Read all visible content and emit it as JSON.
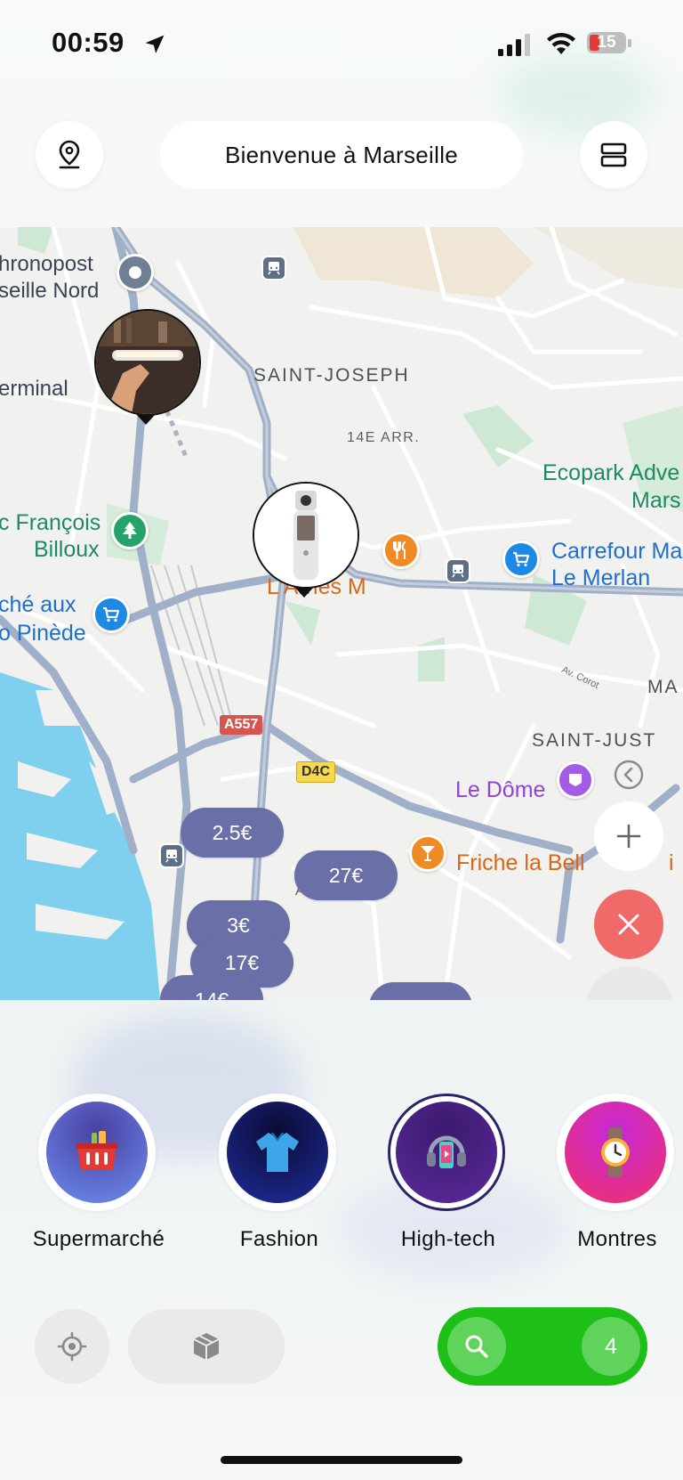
{
  "status_bar": {
    "time": "00:59",
    "battery": "15"
  },
  "header": {
    "title": "Bienvenue à Marseille"
  },
  "map": {
    "labels": {
      "chronopost_1": "hronopost",
      "chronopost_2": "seille Nord",
      "terminal": "erminal",
      "saint_joseph": "SAINT-JOSEPH",
      "arr14": "14E ARR.",
      "ecopark_1": "Ecopark Adve",
      "ecopark_2": "Mars",
      "francois_1": "c François",
      "francois_2": "Billoux",
      "arnavaux": "L'Arnes M",
      "carrefour_1": "Carrefour Ma",
      "carrefour_2": "Le Merlan",
      "marche_1": "ché aux",
      "marche_2": "o Pinède",
      "ma": "MA",
      "saint_just": "SAINT-JUST",
      "le_dome": "Le Dôme",
      "friche": "Friche la Bell",
      "friche_end": "i",
      "arr_bottom": "ARR.",
      "road_a557": "A557",
      "road_d4c": "D4C",
      "road_av": "Av. Corot"
    },
    "prices": [
      "2.5€",
      "27€",
      "3€",
      "17€",
      "14€"
    ]
  },
  "categories": [
    {
      "label": "Supermarché",
      "icon": "basket-icon"
    },
    {
      "label": "Fashion",
      "icon": "shirt-icon"
    },
    {
      "label": "High-tech",
      "icon": "headphones-phone-icon",
      "active": true
    },
    {
      "label": "Montres",
      "icon": "watch-icon"
    }
  ],
  "bottom_bar": {
    "result_count": "4"
  },
  "colors": {
    "accent_green": "#1fbf1a",
    "price_pill": "#6b6fa8",
    "close_red": "#f06a6a"
  }
}
